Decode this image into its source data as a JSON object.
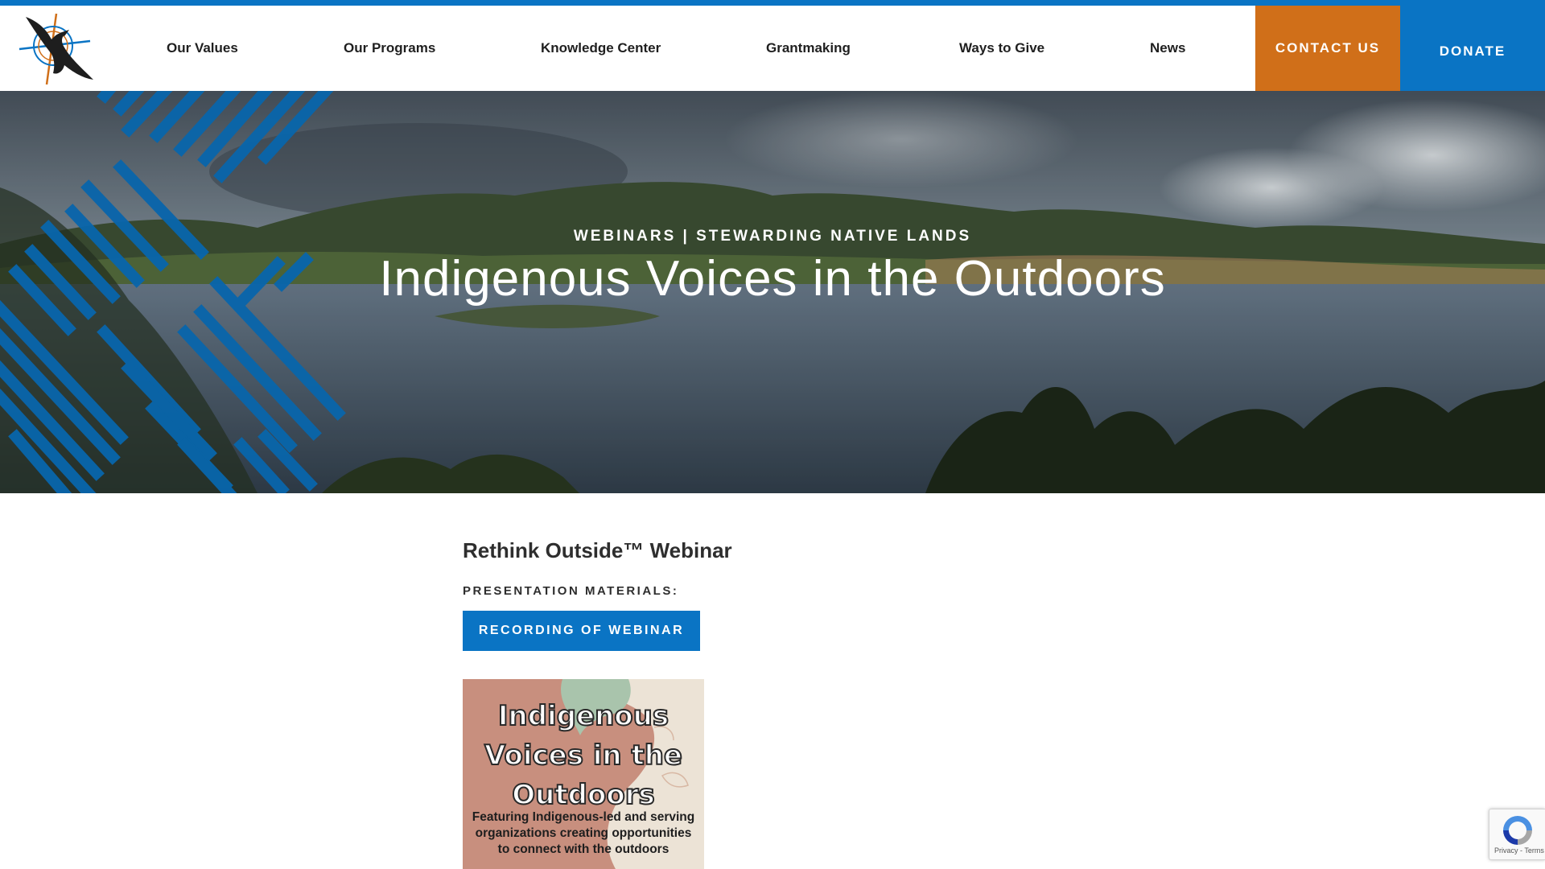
{
  "header": {
    "logo_name": "eagle-compass-logo",
    "nav": [
      {
        "label": "Our Values"
      },
      {
        "label": "Our Programs"
      },
      {
        "label": "Knowledge Center"
      },
      {
        "label": "Grantmaking"
      },
      {
        "label": "Ways to Give"
      },
      {
        "label": "News"
      }
    ],
    "contact_label": "CONTACT US",
    "donate_label": "DONATE"
  },
  "hero": {
    "eyebrow": "WEBINARS | STEWARDING NATIVE LANDS",
    "title": "Indigenous Voices in the Outdoors"
  },
  "content": {
    "section_title": "Rethink Outside™ Webinar",
    "materials_label": "PRESENTATION MATERIALS:",
    "recording_button": "RECORDING OF WEBINAR",
    "poster": {
      "title_lines": [
        "Indigenous",
        "Voices in the",
        "Outdoors"
      ],
      "subtitle": "Featuring Indigenous-led and serving organizations creating opportunities to connect with the outdoors"
    }
  },
  "recaptcha": {
    "footer": "Privacy - Terms"
  },
  "colors": {
    "brand_blue": "#0a74c4",
    "brand_orange": "#d06f19",
    "poster_rose": "#c88f7e",
    "poster_sage": "#a9c4ac"
  }
}
